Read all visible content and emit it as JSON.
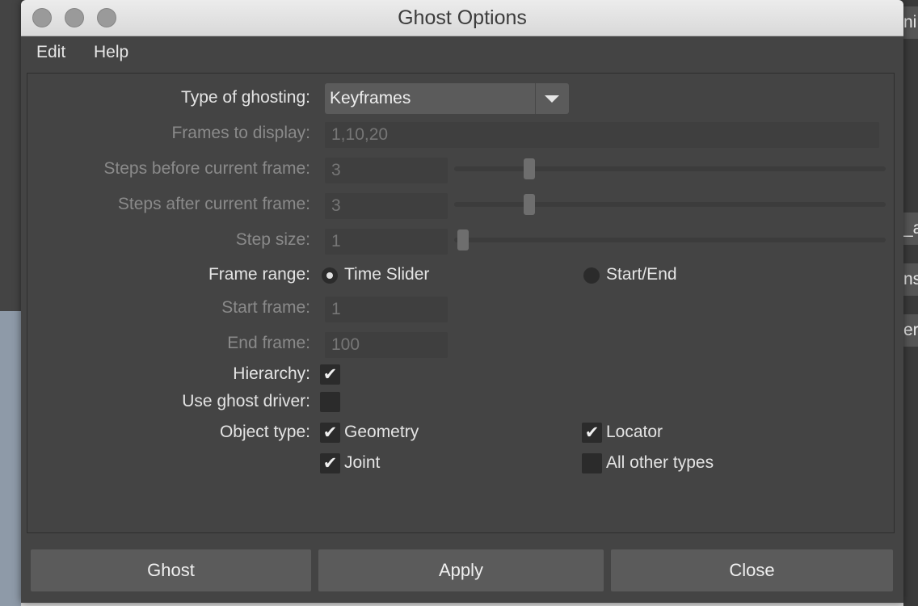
{
  "window": {
    "title": "Ghost Options"
  },
  "background": {
    "right_fragments": [
      "ni",
      "_a",
      "ns",
      "er"
    ]
  },
  "menubar": {
    "items": [
      "Edit",
      "Help"
    ]
  },
  "form": {
    "type_of_ghosting": {
      "label": "Type of ghosting:",
      "value": "Keyframes"
    },
    "frames_to_display": {
      "label": "Frames to display:",
      "value": "1,10,20",
      "enabled": false
    },
    "steps_before": {
      "label": "Steps before current frame:",
      "value": "3",
      "enabled": false,
      "slider_fraction": 0.16
    },
    "steps_after": {
      "label": "Steps after current frame:",
      "value": "3",
      "enabled": false,
      "slider_fraction": 0.16
    },
    "step_size": {
      "label": "Step size:",
      "value": "1",
      "enabled": false,
      "slider_fraction": 0.0
    },
    "frame_range": {
      "label": "Frame range:",
      "options": [
        "Time Slider",
        "Start/End"
      ],
      "selected": "Time Slider"
    },
    "start_frame": {
      "label": "Start frame:",
      "value": "1",
      "enabled": false
    },
    "end_frame": {
      "label": "End frame:",
      "value": "100",
      "enabled": false
    },
    "hierarchy": {
      "label": "Hierarchy:",
      "checked": true
    },
    "use_ghost_driver": {
      "label": "Use ghost driver:",
      "checked": false
    },
    "object_type": {
      "label": "Object type:",
      "geometry": {
        "label": "Geometry",
        "checked": true
      },
      "locator": {
        "label": "Locator",
        "checked": true
      },
      "joint": {
        "label": "Joint",
        "checked": true
      },
      "all_other": {
        "label": "All other types",
        "checked": false
      }
    },
    "check_glyph": "✔"
  },
  "buttons": {
    "ghost": "Ghost",
    "apply": "Apply",
    "close": "Close"
  },
  "colors": {
    "window_bg": "#444444",
    "field_bg": "#3f3f3f",
    "button_bg": "#5b5b5b",
    "text": "#e4e4e4",
    "disabled_text": "#8a8a8a"
  }
}
